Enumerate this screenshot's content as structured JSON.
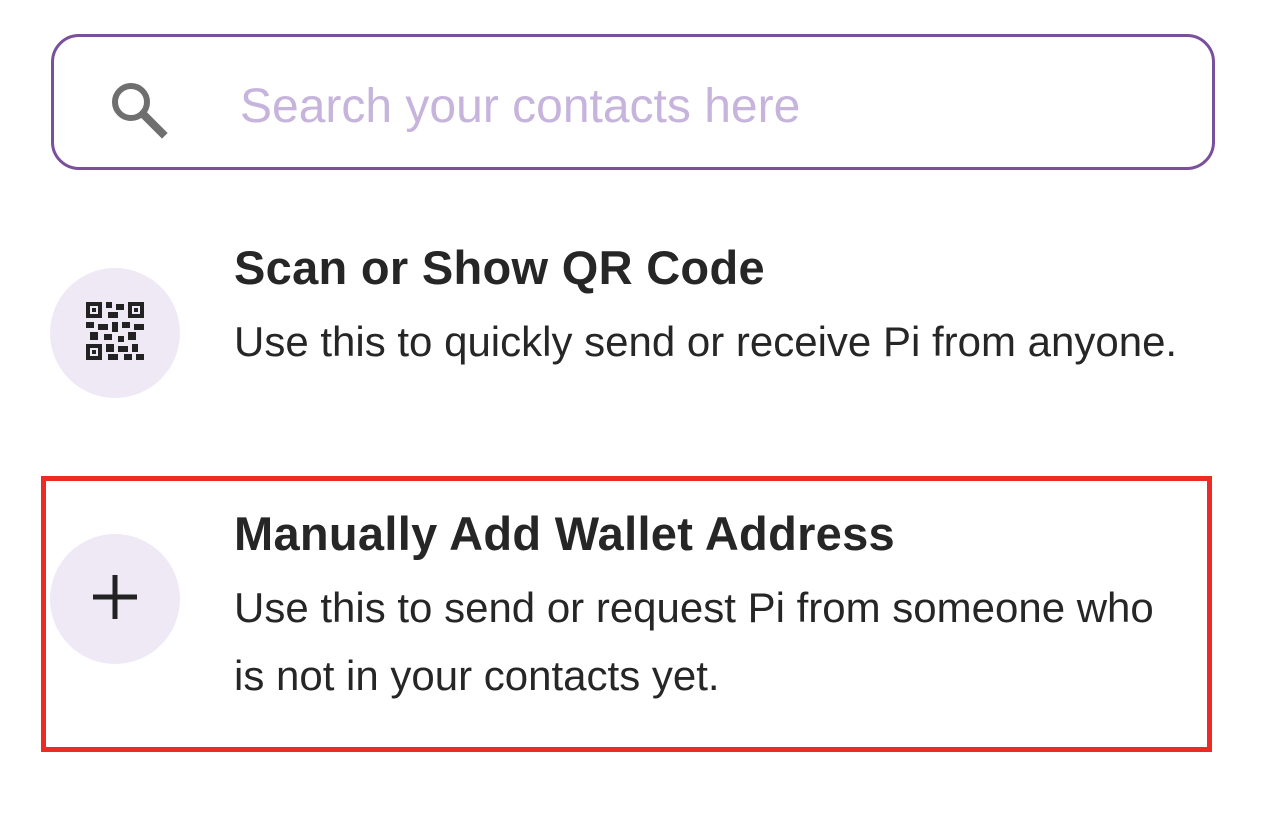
{
  "search": {
    "placeholder": "Search your contacts here",
    "icon": "search-icon",
    "border_color": "#7a4f9c",
    "placeholder_color": "#c6b4dc"
  },
  "options": [
    {
      "icon": "qr-code-icon",
      "title": "Scan or Show QR Code",
      "description": "Use this to quickly send or receive Pi from anyone."
    },
    {
      "icon": "plus-icon",
      "title": "Manually Add Wallet Address",
      "description": "Use this to send or request Pi from someone who is not in your contacts yet.",
      "highlighted": true
    }
  ],
  "colors": {
    "icon_circle_bg": "#efe9f6",
    "highlight_border": "#ee2a24",
    "text": "#262626"
  }
}
